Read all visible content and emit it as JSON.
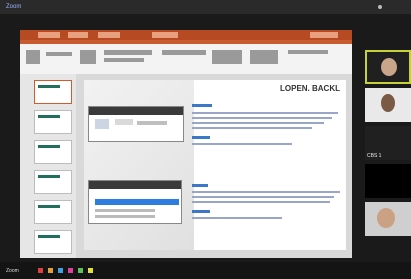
{
  "window": {
    "title": "Zoom"
  },
  "slide": {
    "title": "LOPEN. BACKL"
  },
  "participants": [
    {
      "name": "",
      "active": true
    },
    {
      "name": ""
    },
    {
      "name": "",
      "label": "1"
    },
    {
      "name": ""
    },
    {
      "name": ""
    }
  ],
  "toolbar": {
    "left_label": "Zoom",
    "right_label": "CBS 1"
  },
  "colors": {
    "accent": "#c75a2f",
    "active_border": "#c5d23a"
  }
}
